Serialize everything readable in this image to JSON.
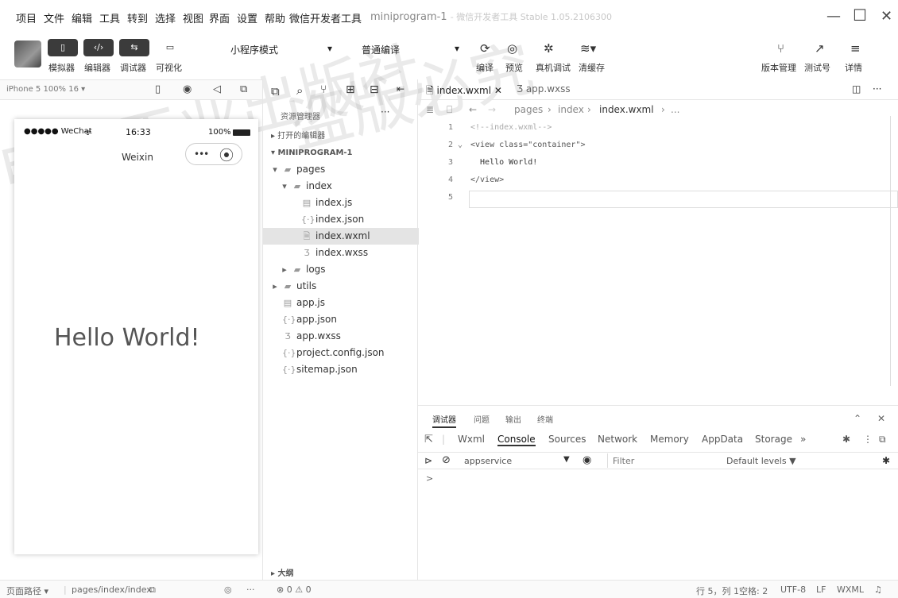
{
  "menu": {
    "items": [
      "项目",
      "文件",
      "编辑",
      "工具",
      "转到",
      "选择",
      "视图",
      "界面",
      "设置",
      "帮助",
      "微信开发者工具"
    ],
    "window_title": "miniprogram-1",
    "window_subtitle": "- 微信开发者工具 Stable 1.05.2106300"
  },
  "toolbar": {
    "buttons": [
      {
        "label": "模拟器",
        "icon": "phone-icon"
      },
      {
        "label": "编辑器",
        "icon": "code-icon"
      },
      {
        "label": "调试器",
        "icon": "debug-icon"
      },
      {
        "label": "可视化",
        "icon": "layout-icon"
      }
    ],
    "mode_select": "小程序模式",
    "compile_select": "普通编译",
    "actions": [
      "编译",
      "预览",
      "真机调试",
      "清缓存"
    ],
    "right_actions": [
      "版本管理",
      "测试号",
      "详情"
    ]
  },
  "simulator": {
    "device_label": "iPhone 5 100% 16 ▾",
    "status_carrier": "●●●●● WeChat",
    "status_time": "16:33",
    "status_battery": "100%",
    "nav_title": "Weixin",
    "page_text": "Hello World!"
  },
  "explorer": {
    "title": "资源管理器",
    "open_editors": "打开的编辑器",
    "project": "MINIPROGRAM-1",
    "tree": [
      {
        "label": "pages",
        "indent": 1,
        "kind": "folder",
        "arrow": "▾"
      },
      {
        "label": "index",
        "indent": 2,
        "kind": "folder",
        "arrow": "▾"
      },
      {
        "label": "index.js",
        "indent": 3,
        "kind": "js"
      },
      {
        "label": "index.json",
        "indent": 3,
        "kind": "json"
      },
      {
        "label": "index.wxml",
        "indent": 3,
        "kind": "wxml",
        "selected": true
      },
      {
        "label": "index.wxss",
        "indent": 3,
        "kind": "wxss"
      },
      {
        "label": "logs",
        "indent": 2,
        "kind": "folder",
        "arrow": "▸"
      },
      {
        "label": "utils",
        "indent": 1,
        "kind": "folder",
        "arrow": "▸"
      },
      {
        "label": "app.js",
        "indent": 1,
        "kind": "js"
      },
      {
        "label": "app.json",
        "indent": 1,
        "kind": "json"
      },
      {
        "label": "app.wxss",
        "indent": 1,
        "kind": "wxss"
      },
      {
        "label": "project.config.json",
        "indent": 1,
        "kind": "json"
      },
      {
        "label": "sitemap.json",
        "indent": 1,
        "kind": "json"
      }
    ],
    "outline": "大纲"
  },
  "editor": {
    "tabs": [
      "index.wxml",
      "app.wxss"
    ],
    "breadcrumb": [
      "pages",
      "index",
      "index.wxml",
      "..."
    ],
    "lines": [
      {
        "n": "1",
        "text": "<!--index.wxml-->"
      },
      {
        "n": "2",
        "text": "<view class=\"container\">"
      },
      {
        "n": "3",
        "text": "  Hello World!"
      },
      {
        "n": "4",
        "text": "</view>"
      },
      {
        "n": "5",
        "text": ""
      }
    ]
  },
  "devtools": {
    "panels": [
      "调试器",
      "问题",
      "输出",
      "终端"
    ],
    "tabs": [
      "Wxml",
      "Console",
      "Sources",
      "Network",
      "Memory",
      "AppData",
      "Storage",
      "»"
    ],
    "active_tab": "Console",
    "context": "appservice",
    "filter_placeholder": "Filter",
    "levels": "Default levels ▼",
    "prompt": ">"
  },
  "statusbar": {
    "page_path_label": "页面路径 ▾",
    "page_path": "pages/index/index",
    "errors": "⊗ 0 ⚠ 0",
    "position": "行 5，列 1",
    "indent": "空格: 2",
    "encoding": "UTF-8",
    "eol": "LF",
    "language": "WXML"
  }
}
